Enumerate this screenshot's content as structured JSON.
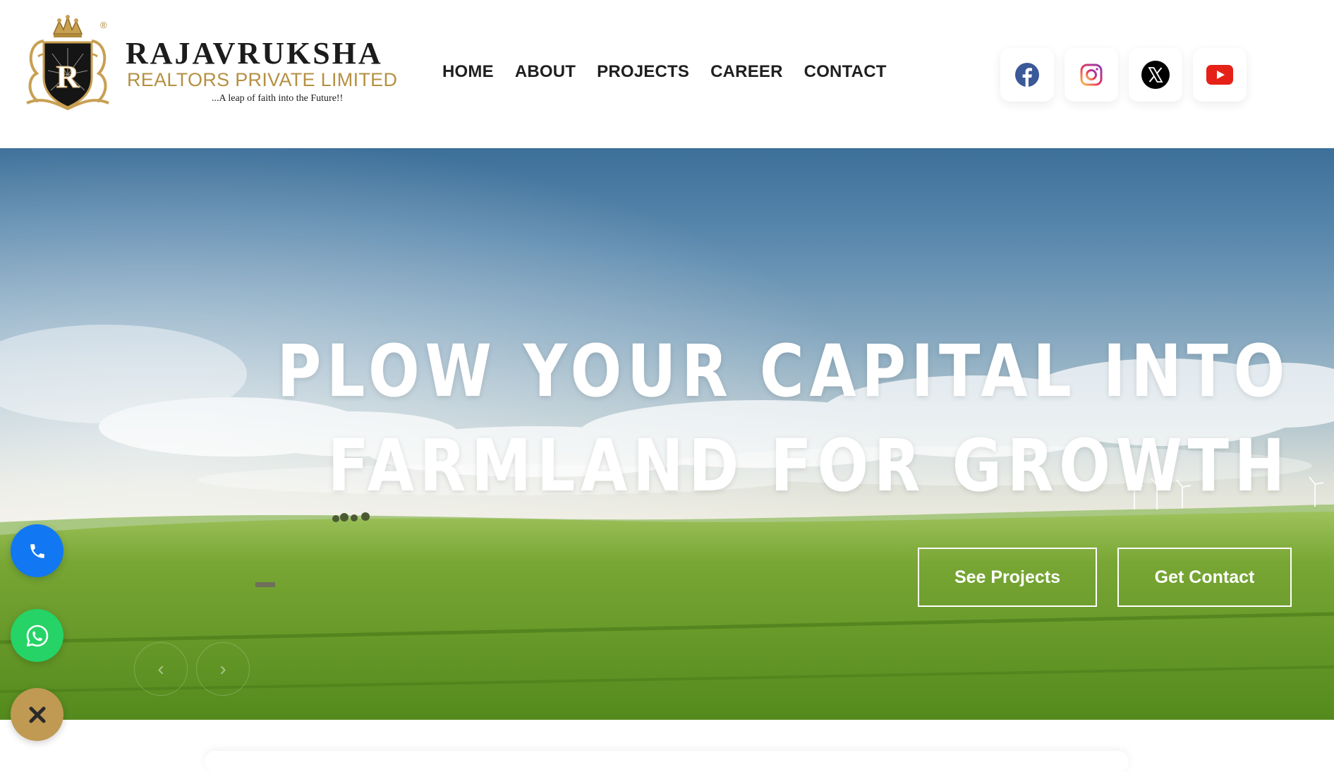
{
  "brand": {
    "name": "RAJAVRUKSHA",
    "subtitle": "REALTORS PRIVATE LIMITED",
    "tagline": "...A leap of faith into the Future!!",
    "crest_letter": "R",
    "registered_mark": "®"
  },
  "nav": {
    "items": [
      {
        "label": "HOME"
      },
      {
        "label": "ABOUT"
      },
      {
        "label": "PROJECTS"
      },
      {
        "label": "CAREER"
      },
      {
        "label": "CONTACT"
      }
    ]
  },
  "socials": [
    {
      "icon": "facebook-icon",
      "color": "#3b5998"
    },
    {
      "icon": "instagram-icon",
      "color": "#d6249f"
    },
    {
      "icon": "x-icon",
      "color": "#000000"
    },
    {
      "icon": "youtube-icon",
      "color": "#e62117"
    }
  ],
  "hero": {
    "title_line1": "PLOW YOUR CAPITAL INTO",
    "title_line2": "FARMLAND FOR GROWTH",
    "primary_button": "See Projects",
    "secondary_button": "Get Contact",
    "prev_arrow": "‹",
    "next_arrow": "›"
  },
  "floating": {
    "call_icon": "phone-icon",
    "call_color": "#1277f3",
    "whatsapp_icon": "whatsapp-icon",
    "whatsapp_color": "#25d366",
    "close_icon": "close-icon",
    "close_color": "#c09a52"
  },
  "colors": {
    "brand_gold": "#b59043",
    "text_dark": "#1f1f1f"
  }
}
